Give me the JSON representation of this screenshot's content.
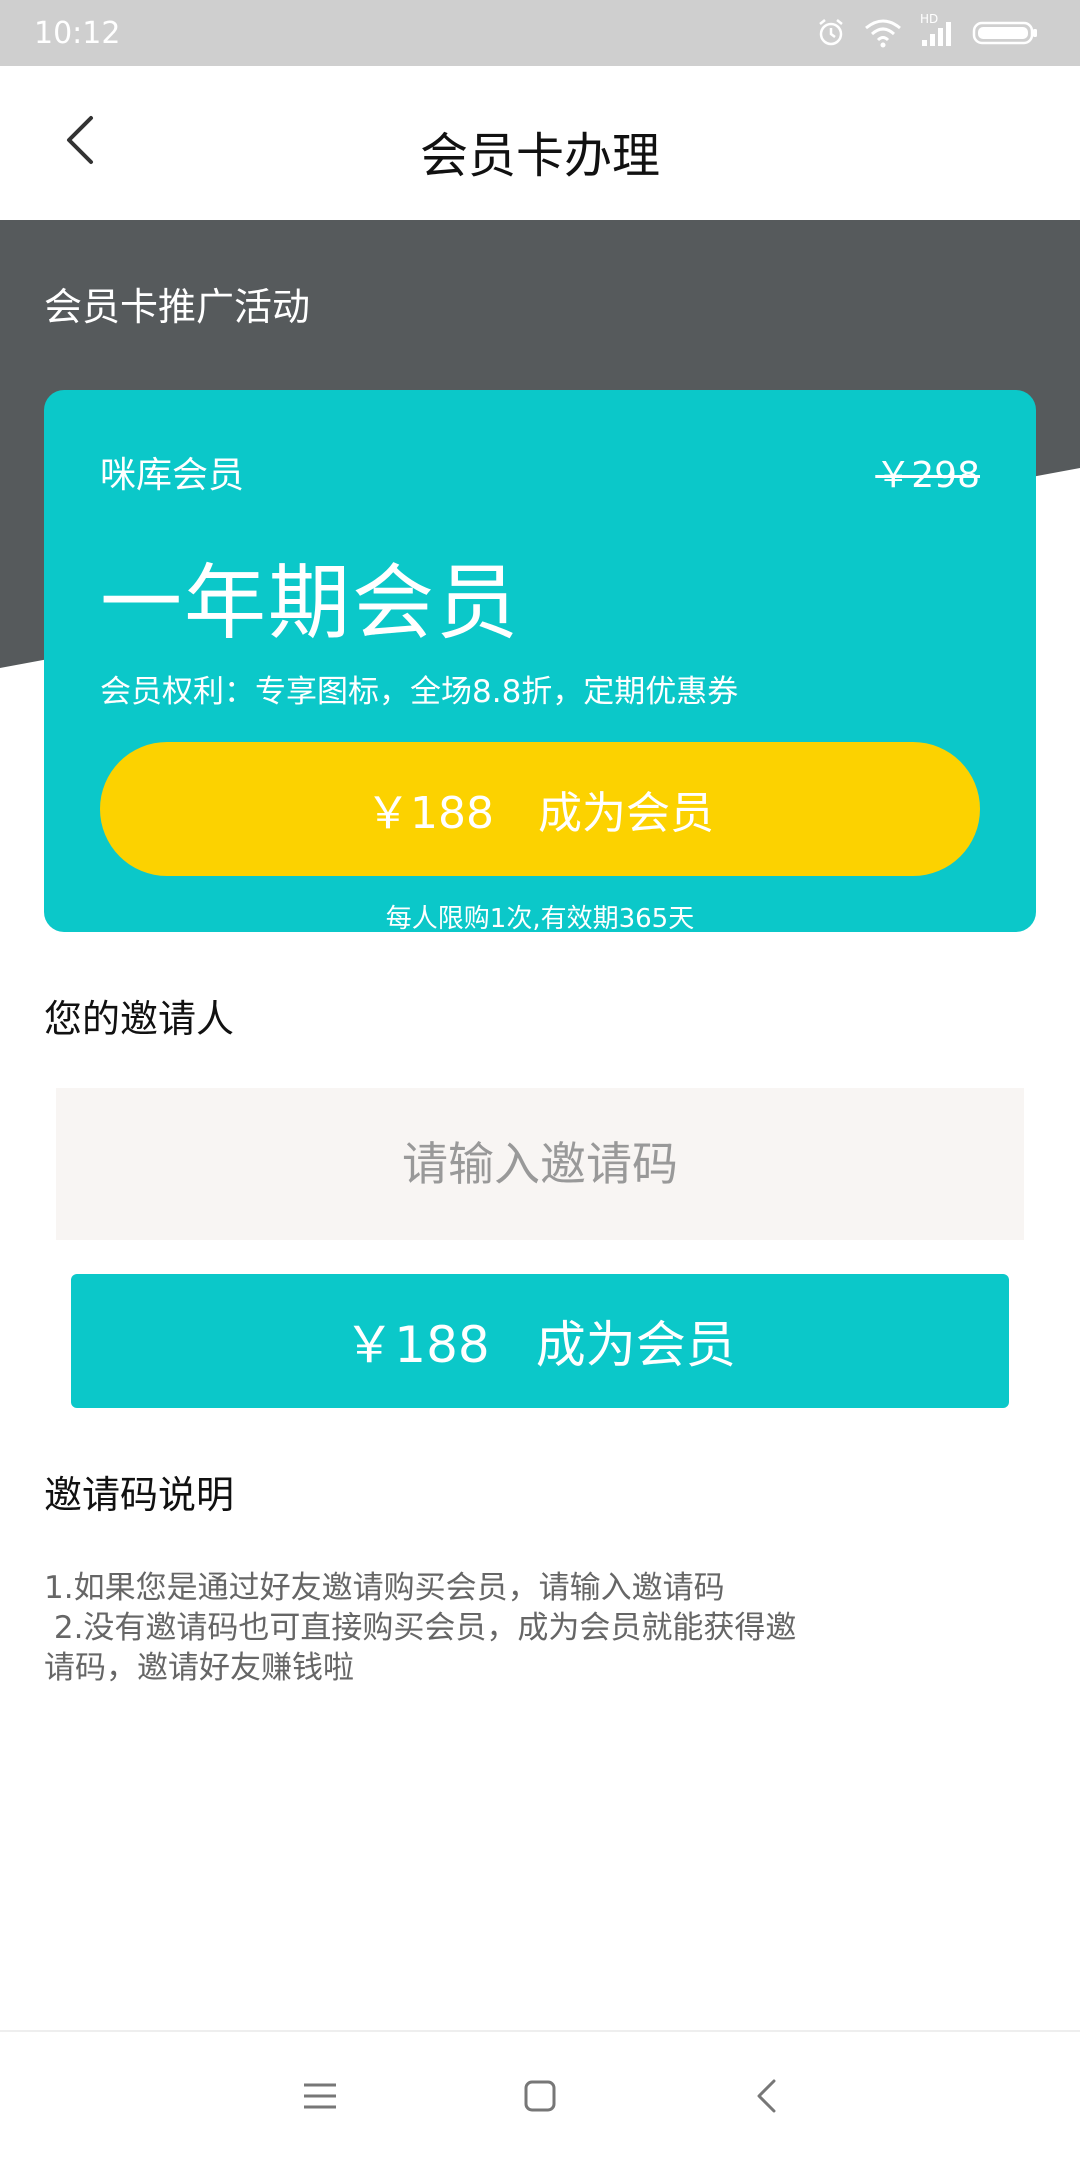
{
  "status_bar": {
    "time": "10:12",
    "icons": [
      "alarm-icon",
      "wifi-icon",
      "signal-icon",
      "battery-icon"
    ],
    "hd_label": "HD"
  },
  "nav": {
    "title": "会员卡办理",
    "back_icon": "chevron-left-icon"
  },
  "banner": {
    "label": "会员卡推广活动"
  },
  "card": {
    "brand": "咪库会员",
    "original_price": "￥298",
    "plan": "一年期会员",
    "benefits": "会员权利：专享图标，全场8.8折，定期优惠券",
    "buy_price": "￥188",
    "buy_label": "成为会员",
    "limit_note": "每人限购1次,有效期365天"
  },
  "inviter": {
    "title": "您的邀请人",
    "placeholder": "请输入邀请码",
    "value": ""
  },
  "main_button": {
    "price": "￥188",
    "label": "成为会员"
  },
  "invite_help": {
    "title": "邀请码说明",
    "lines": [
      "1.如果您是通过好友邀请购买会员，请输入邀请码",
      " 2.没有邀请码也可直接购买会员，成为会员就能获得邀",
      "请码，邀请好友赚钱啦"
    ]
  },
  "system_nav": {
    "icons": [
      "menu-icon",
      "home-square-icon",
      "back-triangle-icon"
    ]
  },
  "colors": {
    "status_bar": "#cfcfcf",
    "banner_dark": "#565a5c",
    "accent_teal": "#0bc8c9",
    "accent_yellow": "#fcd200",
    "input_bg": "#f8f5f3"
  }
}
